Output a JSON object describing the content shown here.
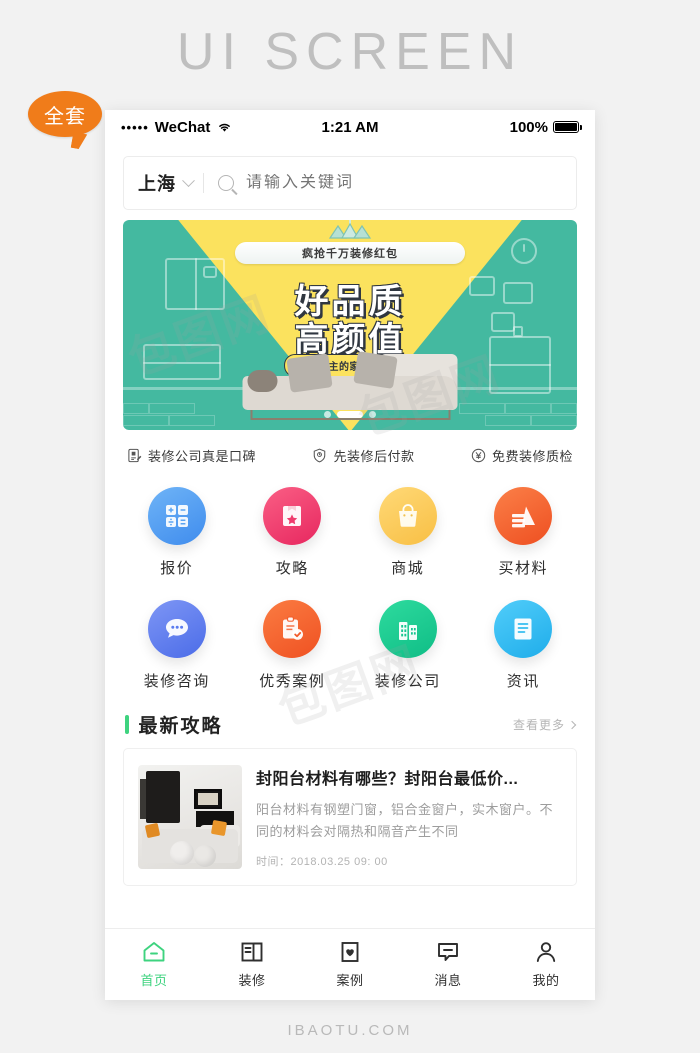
{
  "page": {
    "title": "UI SCREEN",
    "badge": "全套",
    "footer": "IBAOTU.COM",
    "accent_green": "#3ed37f",
    "badge_color": "#f07c1a"
  },
  "statusbar": {
    "signal_dots": "•••••",
    "carrier": "WeChat",
    "wifi_icon": "wifi-icon",
    "time": "1:21 AM",
    "battery_percent": "100%",
    "battery_icon": "battery-full-icon"
  },
  "search": {
    "city": "上海",
    "city_chevron_icon": "chevron-down-icon",
    "search_icon": "search-icon",
    "placeholder": "请输入关键词",
    "value": ""
  },
  "banner": {
    "ribbon": "疯抢千万装修红包",
    "headline_1": "好品质",
    "headline_2": "高颜值",
    "subtitle": "挑剔屋主的家装TOP榜",
    "bg_color": "#44b9a0",
    "beam_color": "#fbe25e",
    "dots_total": 3,
    "dots_active": 1
  },
  "features": [
    {
      "icon": "contract-icon",
      "label": "装修公司真是口碑"
    },
    {
      "icon": "shield-clock-icon",
      "label": "先装修后付款"
    },
    {
      "icon": "yuan-icon",
      "label": "免费装修质检"
    }
  ],
  "grid": [
    {
      "icon": "calculator-icon",
      "label": "报价",
      "color": "#4e9bf0",
      "color2": "#6fb4f7"
    },
    {
      "icon": "bookmark-star-icon",
      "label": "攻略",
      "color": "#ef3b6d",
      "color2": "#f95f86"
    },
    {
      "icon": "shopping-bag-icon",
      "label": "商城",
      "color": "#f5c councils",
      "color2": "#ffd66e"
    },
    {
      "icon": "materials-icon",
      "label": "买材料",
      "color": "#f05a28",
      "color2": "#fa7b3d"
    },
    {
      "icon": "chat-bubble-icon",
      "label": "装修咨询",
      "color": "#5b7cf0",
      "color2": "#7e96f5"
    },
    {
      "icon": "clipboard-check-icon",
      "label": "优秀案例",
      "color": "#f25b2a",
      "color2": "#fb7c42"
    },
    {
      "icon": "building-icon",
      "label": "装修公司",
      "color": "#14c48a",
      "color2": "#2fdb9e"
    },
    {
      "icon": "document-icon",
      "label": "资讯",
      "color": "#2eb7ef",
      "color2": "#4fcaf8"
    }
  ],
  "section": {
    "title": "最新攻略",
    "more": "查看更多",
    "more_chevron_icon": "chevron-right-icon"
  },
  "article": {
    "thumbnail_icon": "living-room-photo",
    "title": "封阳台材料有哪些？封阳台最低价...",
    "description": "阳台材料有钢塑门窗，铝合金窗户，实木窗户。不同的材料会对隔热和隔音产生不同",
    "time_label": "时间：",
    "time_value": "2018.03.25 09: 00"
  },
  "tabs": [
    {
      "icon": "home-icon",
      "label": "首页",
      "active": true
    },
    {
      "icon": "decoration-icon",
      "label": "装修",
      "active": false
    },
    {
      "icon": "case-heart-icon",
      "label": "案例",
      "active": false
    },
    {
      "icon": "message-icon",
      "label": "消息",
      "active": false
    },
    {
      "icon": "person-icon",
      "label": "我的",
      "active": false
    }
  ],
  "watermarks": [
    "包图网",
    "包图网",
    "包图网"
  ]
}
